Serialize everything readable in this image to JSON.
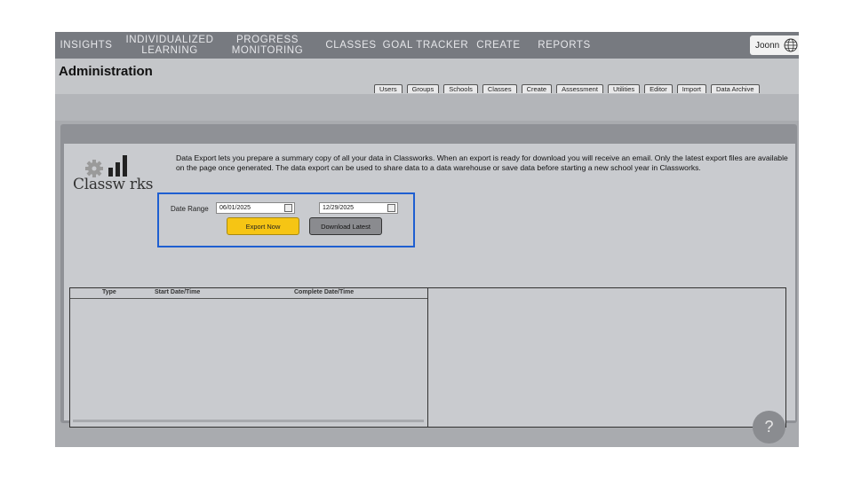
{
  "nav": {
    "insights": "INSIGHTS",
    "individualized_line1": "INDIVIDUALIZED",
    "individualized_line2": "LEARNING",
    "progress_line1": "PROGRESS",
    "progress_line2": "MONITORING",
    "classes": "CLASSES",
    "goal_tracker": "GOAL TRACKER",
    "create": "CREATE",
    "reports": "REPORTS",
    "user_name": "Joonn",
    "user_icon": "globe-icon"
  },
  "header": {
    "title": "Administration",
    "tabs": [
      "Users",
      "Groups",
      "Schools",
      "Classes",
      "Create",
      "Assessment",
      "Utilities",
      "Editor",
      "Import",
      "Data Archive"
    ]
  },
  "export": {
    "logo_text": "Classw rks",
    "description": "Data Export lets you prepare a summary copy of all your data in Classworks. When an export is ready for download you will receive an email. Only the latest export files are available on the page once generated. The data export can be used to share data to a data warehouse or save data before starting a new school year in Classworks.",
    "date_range_label": "Date Range",
    "start_date": "06/01/2025",
    "end_date": "12/29/2025",
    "export_button": "Export Now",
    "download_button": "Download Latest"
  },
  "table": {
    "columns": [
      "Type",
      "Start Date/Time",
      "Complete Date/Time"
    ],
    "rows": []
  },
  "help": {
    "label": "?"
  },
  "colors": {
    "accent_border": "#1e5fd1",
    "export_button": "#f6c514",
    "nav_bg": "#777a80"
  }
}
